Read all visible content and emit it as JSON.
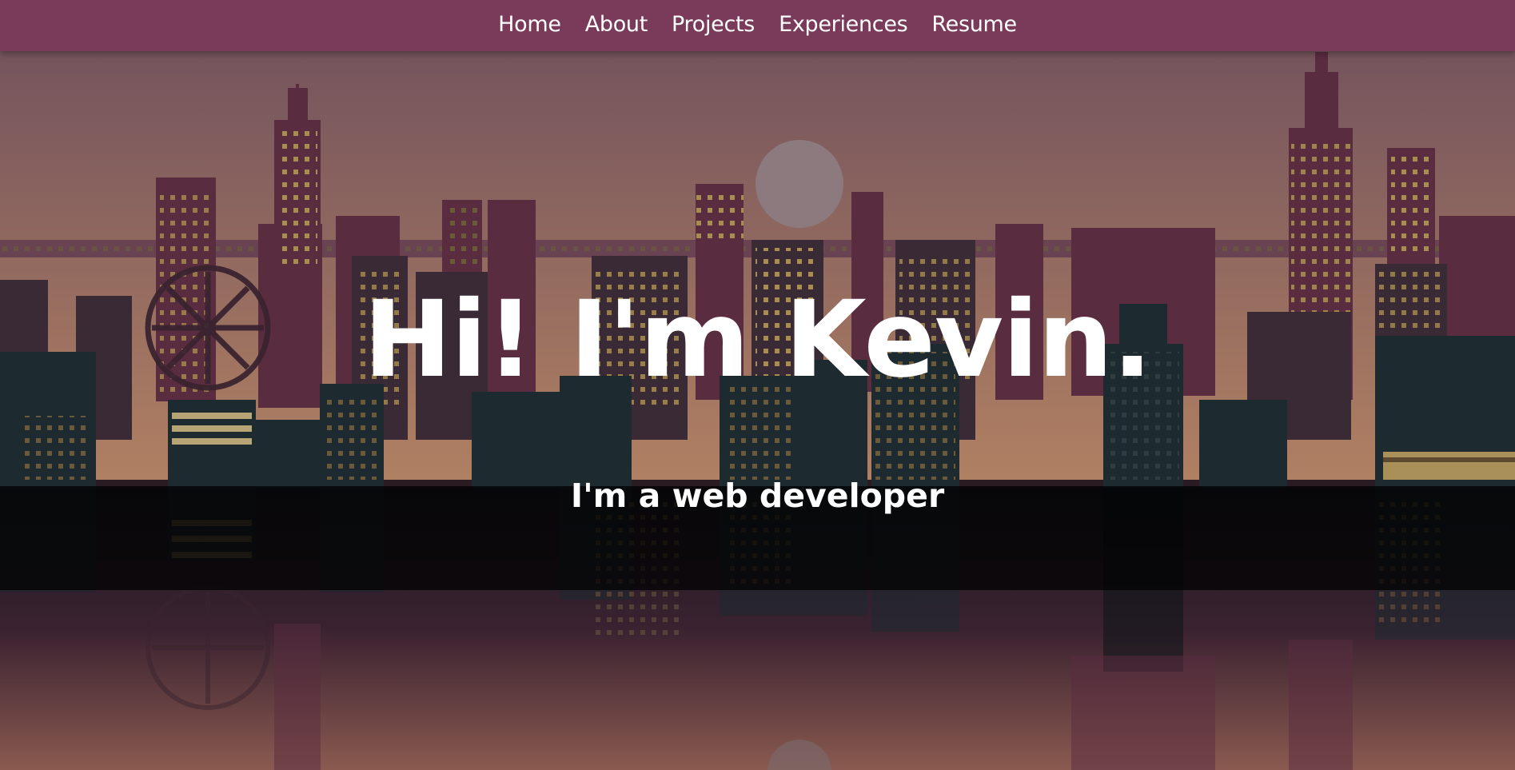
{
  "nav": {
    "items": [
      {
        "label": "Home"
      },
      {
        "label": "About"
      },
      {
        "label": "Projects"
      },
      {
        "label": "Experiences"
      },
      {
        "label": "Resume"
      }
    ]
  },
  "hero": {
    "title": "Hi! I'm Kevin.",
    "subtitle": "I'm a web developer",
    "background": "pixel-art-city-skyline-at-dusk"
  },
  "colors": {
    "nav_background": "#7a3a59",
    "sky_top": "#6e4f5c",
    "sky_bottom": "#b08062",
    "building_dark": "#1d2a30",
    "building_mid": "#5a2c40",
    "window_light": "#a88e4e",
    "text": "#ffffff"
  }
}
